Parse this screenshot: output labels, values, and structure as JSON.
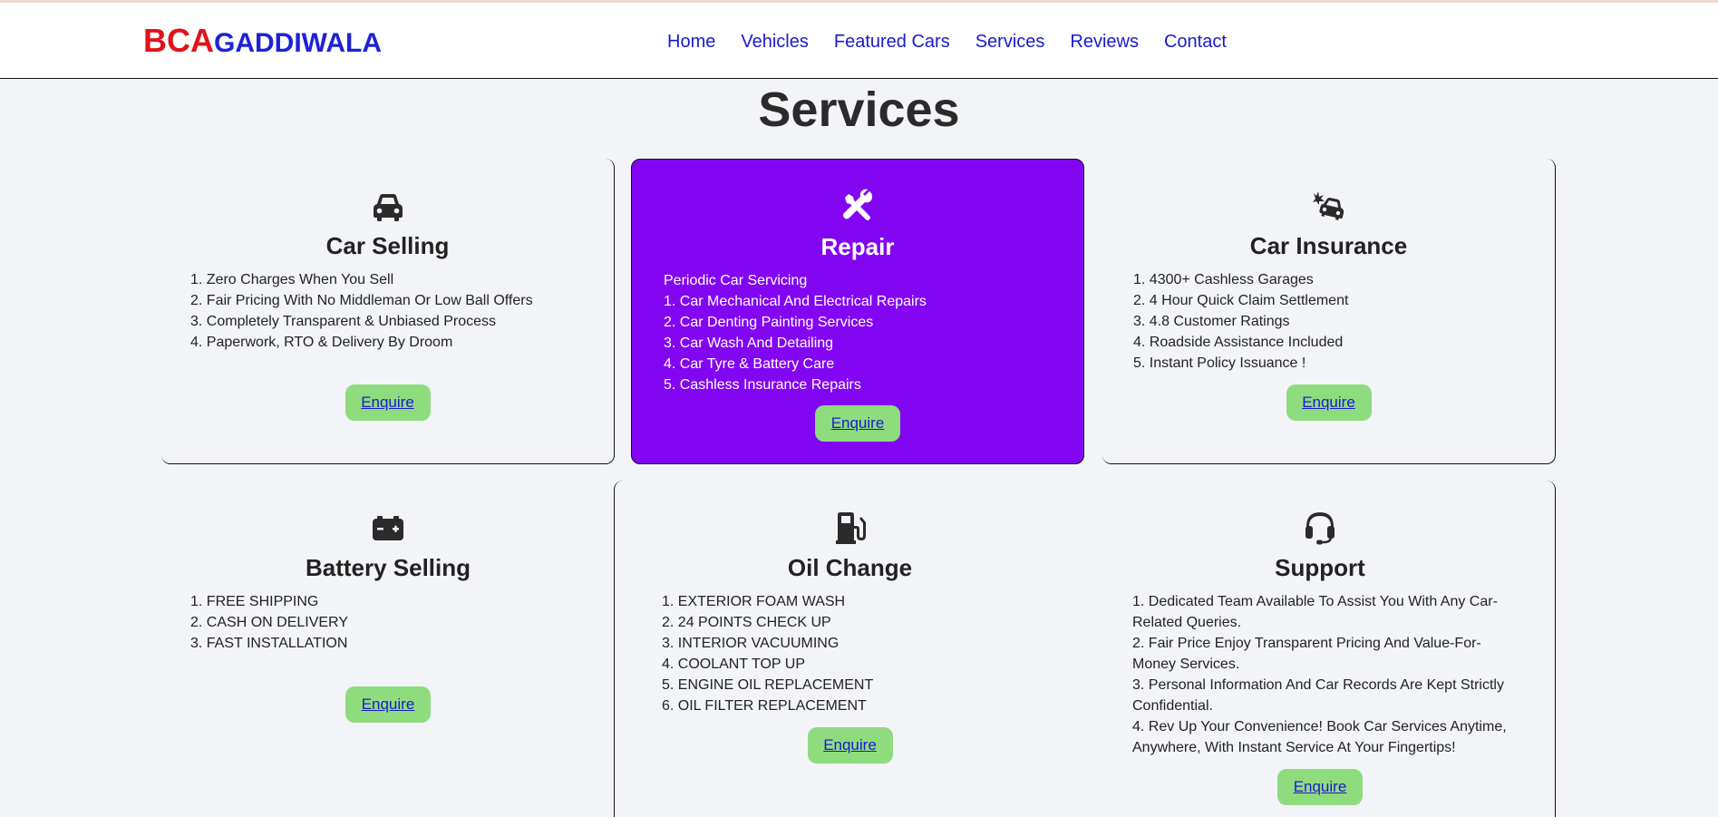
{
  "brand": {
    "part1": "BCA",
    "part2": "GADDIWALA",
    "color1": "#e0141b",
    "color2": "#1c22d6"
  },
  "nav": [
    "Home",
    "Vehicles",
    "Featured Cars",
    "Services",
    "Reviews",
    "Contact"
  ],
  "page_title": "Services",
  "accent": {
    "highlight": "#8306f3",
    "button": "#8fdc7e",
    "link": "#1a1ad0"
  },
  "cards": [
    {
      "icon": "car-icon",
      "title": "Car Selling",
      "items": [
        "1. Zero Charges When You Sell",
        "2. Fair Pricing With No Middleman Or Low Ball Offers",
        "3. Completely Transparent & Unbiased Process",
        "4. Paperwork, RTO & Delivery By Droom"
      ],
      "button": "Enquire"
    },
    {
      "icon": "tools-icon",
      "title": "Repair",
      "items": [
        "Periodic Car Servicing",
        "1. Car Mechanical And Electrical Repairs",
        "2. Car Denting Painting Services",
        "3. Car Wash And Detailing",
        "4. Car Tyre & Battery Care",
        "5. Cashless Insurance Repairs"
      ],
      "button": "Enquire"
    },
    {
      "icon": "car-burst-icon",
      "title": "Car Insurance",
      "items": [
        "1. 4300+ Cashless Garages",
        "2. 4 Hour Quick Claim Settlement",
        "3. 4.8 Customer Ratings",
        "4. Roadside Assistance Included",
        "5. Instant Policy Issuance !"
      ],
      "button": "Enquire"
    },
    {
      "icon": "car-battery-icon",
      "title": "Battery Selling",
      "items": [
        "1. FREE SHIPPING",
        "2. CASH ON DELIVERY",
        "3. FAST INSTALLATION"
      ],
      "button": "Enquire"
    },
    {
      "icon": "gas-pump-icon",
      "title": "Oil Change",
      "items": [
        "1. EXTERIOR FOAM WASH",
        "2. 24 POINTS CHECK UP",
        "3. INTERIOR VACUUMING",
        "4. COOLANT TOP UP",
        "5. ENGINE OIL REPLACEMENT",
        "6. OIL FILTER REPLACEMENT"
      ],
      "button": "Enquire"
    },
    {
      "icon": "headset-icon",
      "title": "Support",
      "items": [
        "1. Dedicated Team Available To Assist You With Any Car-Related Queries.",
        "2. Fair Price Enjoy Transparent Pricing And Value-For-Money Services.",
        "3. Personal Information And Car Records Are Kept Strictly Confidential.",
        "4. Rev Up Your Convenience! Book Car Services Anytime, Anywhere, With Instant Service At Your Fingertips!"
      ],
      "button": "Enquire"
    }
  ]
}
